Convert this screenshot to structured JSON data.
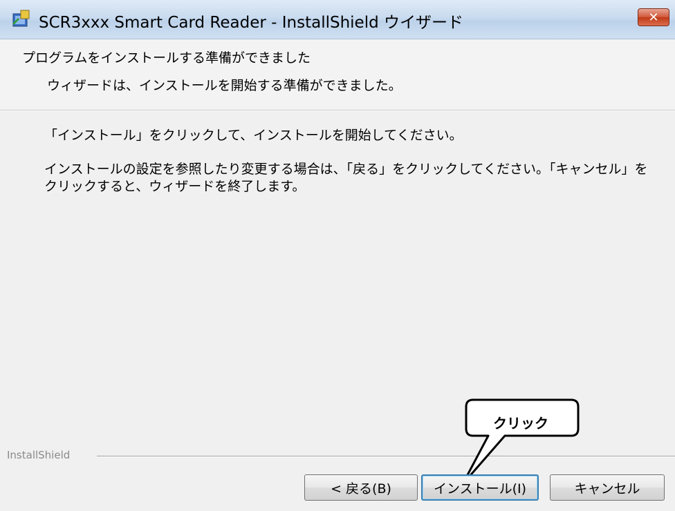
{
  "window": {
    "title": "SCR3xxx Smart Card Reader - InstallShield ウイザード",
    "close_label": "✕"
  },
  "header": {
    "title": "プログラムをインストールする準備ができました",
    "subtitle": "ウィザードは、インストールを開始する準備ができました。"
  },
  "body": {
    "paragraph1": "「インストール」をクリックして、インストールを開始してください。",
    "paragraph2": "インストールの設定を参照したり変更する場合は、「戻る」をクリックしてください。「キャンセル」をクリックすると、ウィザードを終了します。"
  },
  "footer": {
    "brand": "InstallShield"
  },
  "buttons": {
    "back": "< 戻る(B)",
    "install": "インストール(I)",
    "cancel": "キャンセル"
  },
  "callout": {
    "text": "クリック"
  },
  "colors": {
    "accent_focus": "#3c7fb1",
    "close_red": "#c23a17"
  },
  "icons": {
    "app": "installer-package-icon",
    "close": "close-icon"
  }
}
